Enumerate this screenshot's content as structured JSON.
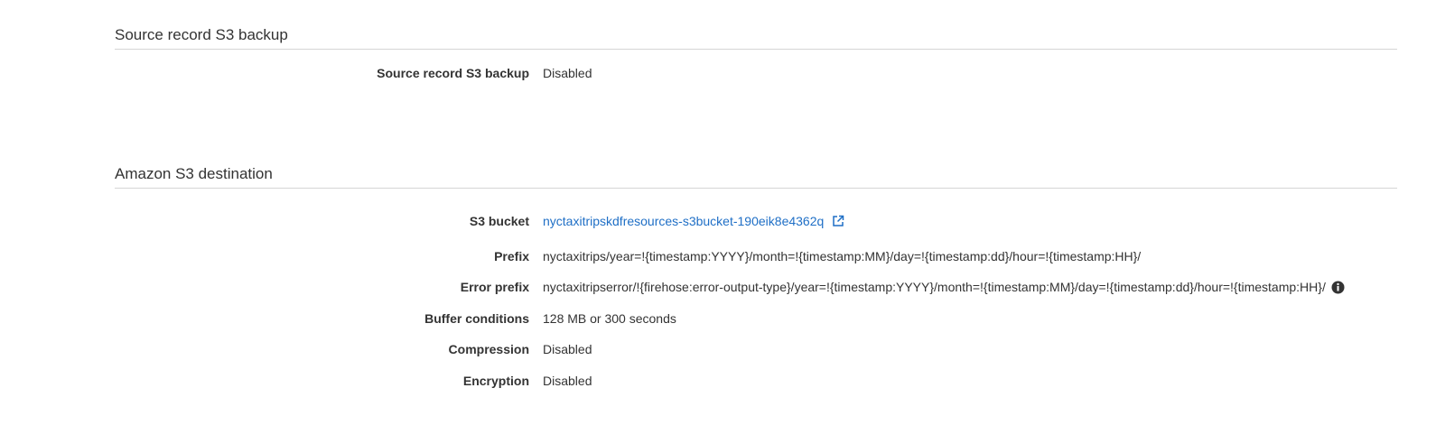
{
  "source_backup": {
    "title": "Source record S3 backup",
    "rows": [
      {
        "label": "Source record S3 backup",
        "value": "Disabled"
      }
    ]
  },
  "s3_destination": {
    "title": "Amazon S3 destination",
    "bucket": {
      "label": "S3 bucket",
      "value": "nyctaxitripskdfresources-s3bucket-190eik8e4362q"
    },
    "prefix": {
      "label": "Prefix",
      "value": "nyctaxitrips/year=!{timestamp:YYYY}/month=!{timestamp:MM}/day=!{timestamp:dd}/hour=!{timestamp:HH}/"
    },
    "error_prefix": {
      "label": "Error prefix",
      "value": "nyctaxitripserror/!{firehose:error-output-type}/year=!{timestamp:YYYY}/month=!{timestamp:MM}/day=!{timestamp:dd}/hour=!{timestamp:HH}/"
    },
    "buffer": {
      "label": "Buffer conditions",
      "value": "128 MB or 300 seconds"
    },
    "compression": {
      "label": "Compression",
      "value": "Disabled"
    },
    "encryption": {
      "label": "Encryption",
      "value": "Disabled"
    }
  },
  "icons": {
    "external_link": "external-link-icon",
    "info": "info-icon"
  },
  "colors": {
    "link": "#1f6fc6",
    "text": "#333333",
    "divider": "#d5d5d5"
  }
}
